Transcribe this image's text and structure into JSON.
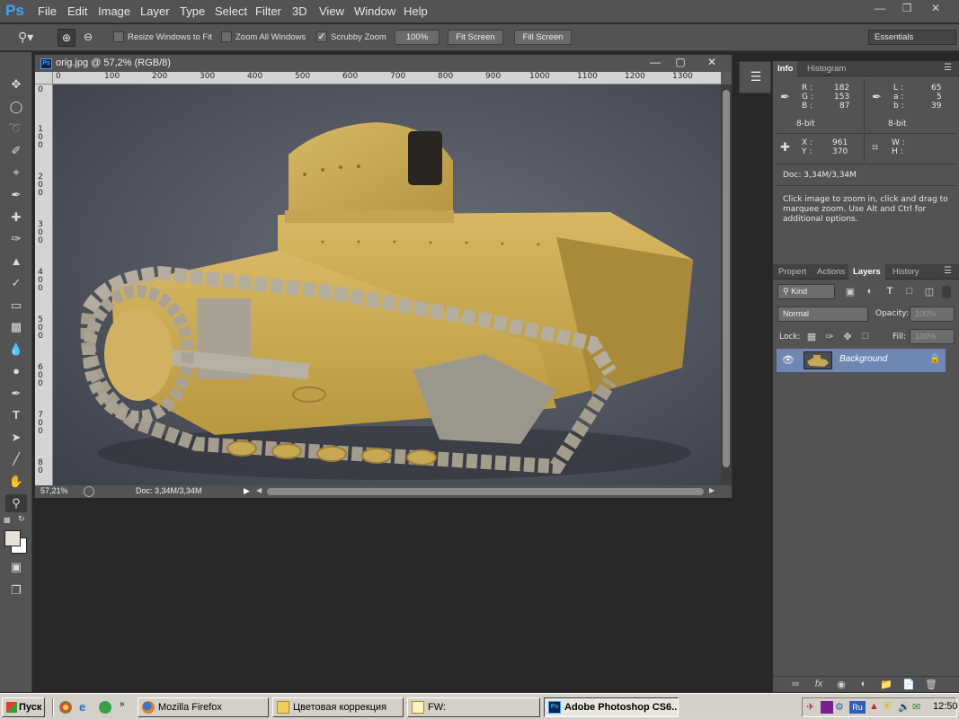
{
  "app": {
    "logo": "Ps",
    "menu": [
      "File",
      "Edit",
      "Image",
      "Layer",
      "Type",
      "Select",
      "Filter",
      "3D",
      "View",
      "Window",
      "Help"
    ],
    "window_controls": [
      "minimize-icon",
      "restore-icon",
      "close-icon"
    ]
  },
  "options_bar": {
    "resize_windows_label": "Resize Windows to Fit",
    "resize_windows_checked": false,
    "zoom_all_label": "Zoom All Windows",
    "zoom_all_checked": false,
    "scrubby_zoom_label": "Scrubby Zoom",
    "scrubby_zoom_checked": true,
    "btn_100": "100%",
    "btn_fit_screen": "Fit Screen",
    "btn_fill_screen": "Fill Screen",
    "workspace": "Essentials"
  },
  "document": {
    "title": "orig.jpg @ 57,2% (RGB/8)",
    "tab_icon": "Ps",
    "ruler_h": [
      "0",
      "100",
      "200",
      "300",
      "400",
      "500",
      "600",
      "700",
      "800",
      "900",
      "1000",
      "1100",
      "1200",
      "1300"
    ],
    "ruler_v": [
      "0",
      "1",
      "0",
      "0",
      "2",
      "0",
      "0",
      "3",
      "0",
      "0",
      "4",
      "0",
      "0",
      "5",
      "0",
      "0",
      "6",
      "0",
      "0",
      "7",
      "0",
      "0",
      "8",
      "0"
    ],
    "zoom_level": "57,21%",
    "doc_size": "Doc: 3,34M/3,34M"
  },
  "info_panel": {
    "tabs": [
      "Info",
      "Histogram"
    ],
    "active_tab": "Info",
    "rgb": {
      "R_label": "R :",
      "R": "182",
      "G_label": "G :",
      "G": "153",
      "B_label": "B :",
      "B": "87",
      "depth": "8-bit"
    },
    "lab": {
      "L_label": "L :",
      "L": "65",
      "a_label": "a :",
      "a": "5",
      "b_label": "b :",
      "b": "39",
      "depth": "8-bit"
    },
    "xy": {
      "X_label": "X :",
      "X": "961",
      "Y_label": "Y :",
      "Y": "370"
    },
    "wh": {
      "W_label": "W :",
      "H_label": "H :"
    },
    "doc": "Doc: 3,34M/3,34M",
    "hint": "Click image to zoom in, click and drag to marquee zoom.  Use Alt and Ctrl for additional options."
  },
  "layers_panel": {
    "tabs": [
      "Propert",
      "Actions",
      "Layers",
      "History"
    ],
    "active_tab": "Layers",
    "kind_label": "Kind",
    "blend_mode": "Normal",
    "opacity_label": "Opacity:",
    "opacity": "100%",
    "lock_label": "Lock:",
    "fill_label": "Fill:",
    "fill": "100%",
    "layers": [
      {
        "name": "Background",
        "visible": true,
        "locked": true
      }
    ]
  },
  "taskbar": {
    "start": "Пуск",
    "buttons": [
      {
        "label": "Mozilla Firefox",
        "active": false
      },
      {
        "label": "Цветовая коррекция",
        "active": false
      },
      {
        "label": "FW:",
        "active": false
      },
      {
        "label": "Adobe Photoshop CS6...",
        "active": true
      }
    ],
    "tray_lang": "Ru",
    "clock": "12:50"
  },
  "colors": {
    "ps_accent": "#3ea4ff",
    "panel_bg": "#535353",
    "workspace_bg": "#282828",
    "selected_layer": "#6f88b3"
  }
}
